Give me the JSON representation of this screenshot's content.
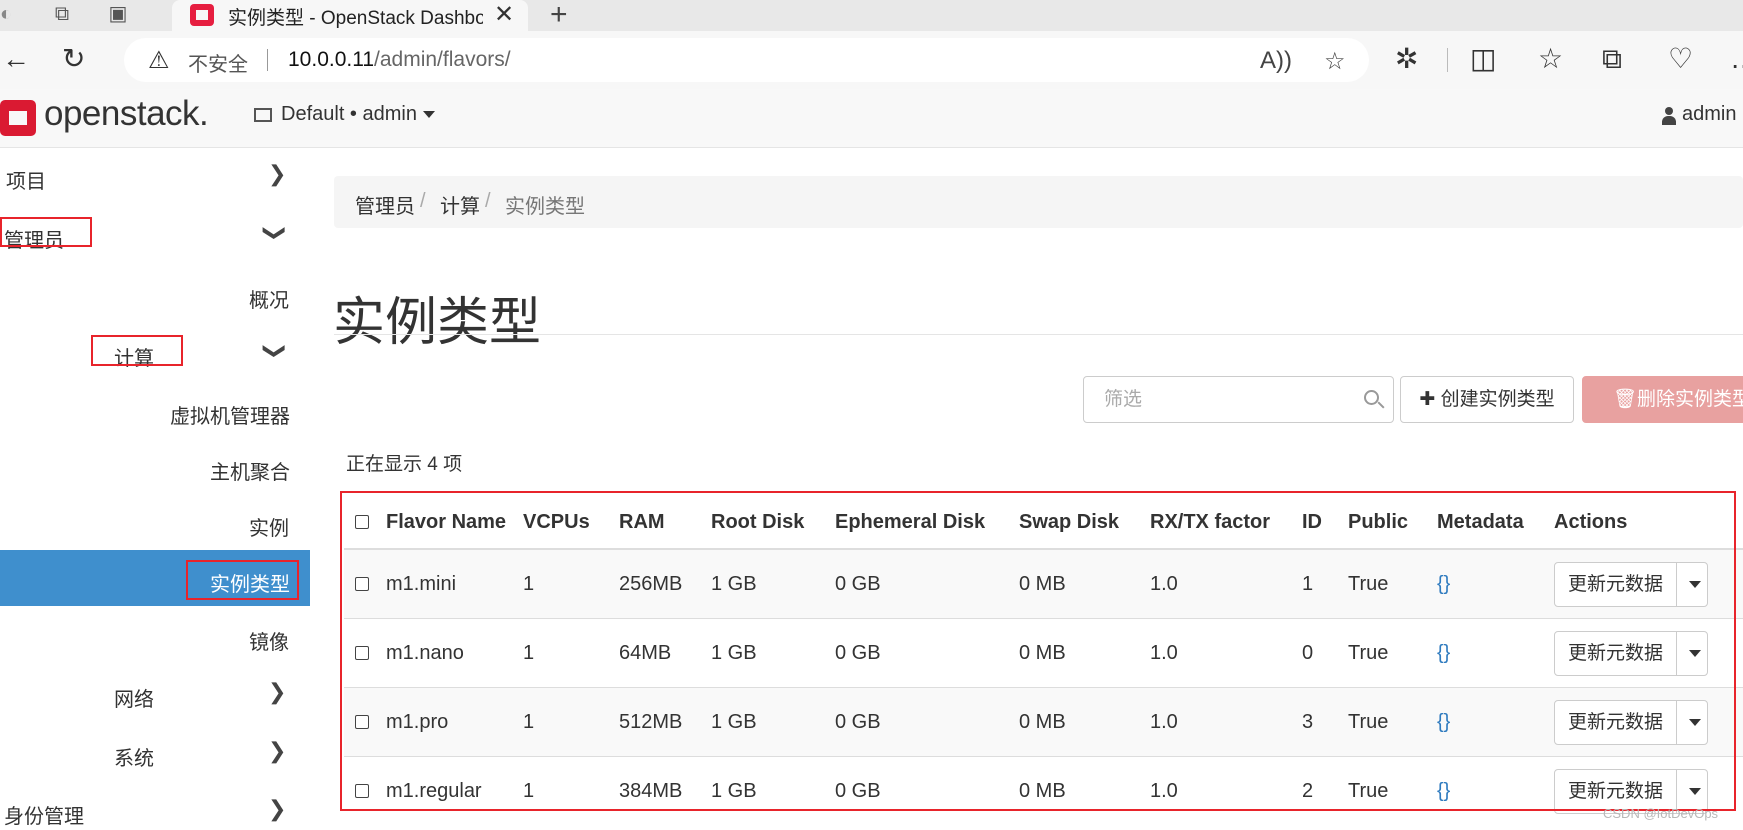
{
  "browser": {
    "tab_title": "实例类型 - OpenStack Dashboard",
    "omnibox": {
      "security_label": "不安全",
      "url_host": "10.0.0.11",
      "url_path": "/admin/flavors/"
    }
  },
  "header": {
    "logo_text": "openstack.",
    "project_selector": "Default • admin",
    "user_menu": "admin"
  },
  "sidebar": {
    "project": "项目",
    "admin": "管理员",
    "overview": "概况",
    "compute": "计算",
    "hypervisors": "虚拟机管理器",
    "host_aggregates": "主机聚合",
    "instances": "实例",
    "flavors": "实例类型",
    "images": "镜像",
    "network": "网络",
    "system": "系统",
    "identity": "身份管理"
  },
  "breadcrumb": {
    "level1": "管理员",
    "level2": "计算",
    "current": "实例类型",
    "separator": "/"
  },
  "page_title": "实例类型",
  "actions": {
    "filter_placeholder": "筛选",
    "create_label": "创建实例类型",
    "delete_label": "删除实例类型"
  },
  "summary": "正在显示 4 项",
  "table": {
    "columns": [
      "Flavor Name",
      "VCPUs",
      "RAM",
      "Root Disk",
      "Ephemeral Disk",
      "Swap Disk",
      "RX/TX factor",
      "ID",
      "Public",
      "Metadata",
      "Actions"
    ],
    "rows": [
      {
        "name": "m1.mini",
        "vcpus": "1",
        "ram": "256MB",
        "root_disk": "1 GB",
        "ephemeral_disk": "0 GB",
        "swap_disk": "0 MB",
        "rxtx_factor": "1.0",
        "id": "1",
        "public": "True",
        "metadata": "{}",
        "action": "更新元数据"
      },
      {
        "name": "m1.nano",
        "vcpus": "1",
        "ram": "64MB",
        "root_disk": "1 GB",
        "ephemeral_disk": "0 GB",
        "swap_disk": "0 MB",
        "rxtx_factor": "1.0",
        "id": "0",
        "public": "True",
        "metadata": "{}",
        "action": "更新元数据"
      },
      {
        "name": "m1.pro",
        "vcpus": "1",
        "ram": "512MB",
        "root_disk": "1 GB",
        "ephemeral_disk": "0 GB",
        "swap_disk": "0 MB",
        "rxtx_factor": "1.0",
        "id": "3",
        "public": "True",
        "metadata": "{}",
        "action": "更新元数据"
      },
      {
        "name": "m1.regular",
        "vcpus": "1",
        "ram": "384MB",
        "root_disk": "1 GB",
        "ephemeral_disk": "0 GB",
        "swap_disk": "0 MB",
        "rxtx_factor": "1.0",
        "id": "2",
        "public": "True",
        "metadata": "{}",
        "action": "更新元数据"
      }
    ]
  },
  "watermark": "CSDN @IotDevOps",
  "colors": {
    "accent": "#3f8fcd",
    "brand_red": "#da1a32",
    "danger_button": "#e8a1a0",
    "highlight_outline": "#e8242b",
    "link": "#2f7bbf"
  }
}
